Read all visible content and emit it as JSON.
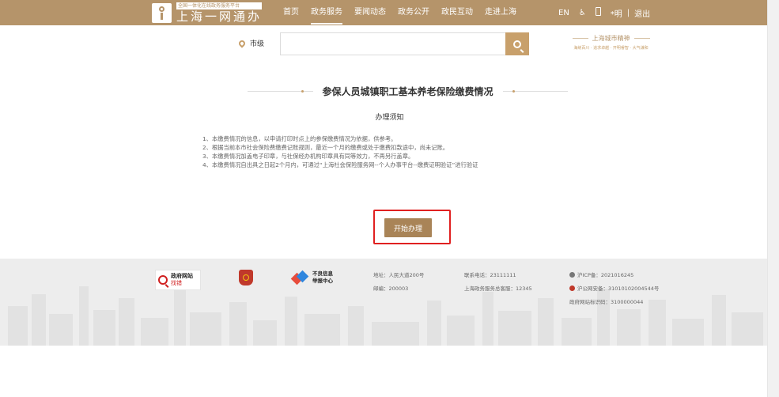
{
  "header": {
    "logo_sub": "全国一体化在线政务服务平台",
    "logo_main": "上海一网通办",
    "nav": [
      {
        "label": "首页",
        "active": false
      },
      {
        "label": "政务服务",
        "active": true
      },
      {
        "label": "要闻动态",
        "active": false
      },
      {
        "label": "政务公开",
        "active": false
      },
      {
        "label": "政民互动",
        "active": false
      },
      {
        "label": "走进上海",
        "active": false
      }
    ],
    "lang": "EN",
    "accessibility_glyph": "♿",
    "user": "*明",
    "divider": "|",
    "logout": "退出"
  },
  "search": {
    "location": "市级",
    "value": "",
    "placeholder": ""
  },
  "spirit": {
    "title": "上海城市精神",
    "subtitle": "海纳百川 · 追求卓越 · 开明睿智 · 大气谦和"
  },
  "main": {
    "title": "参保人员城镇职工基本养老保险缴费情况",
    "notice_heading": "办理须知",
    "notices": [
      "1、本缴费情况的信息，以申请打印时点上的参保缴费情况为依据，供参考。",
      "2、根据当前本市社会保险费缴费记账规则，最近一个月的缴费或处于缴费扣款途中，尚未记账。",
      "3、本缴费情况加盖电子印章，与社保经办机构印章具有同等效力，不再另行盖章。",
      "4、本缴费情况自出具之日起2个月内，可通过“上海社会保险服务网--个人办事平台--缴费证明验证”进行验证"
    ],
    "start_button": "开始办理"
  },
  "footer": {
    "gov_site_line1": "政府网站",
    "gov_site_line2": "找错",
    "report_line1": "不良信息",
    "report_line2": "举报中心",
    "address": "地址：人民大道200号",
    "postcode": "邮编：200003",
    "phone": "联系电话：23111111",
    "hotline": "上海政务服务总客服：12345",
    "icp": "沪ICP备：2021016245",
    "police": "沪公网安备：31010102004544号",
    "site_id": "政府网站标识码：3100000044"
  },
  "colors": {
    "header_bg": "#b5946a",
    "accent": "#c8a06b",
    "start_button_bg": "#a98457",
    "highlight": "#e02020",
    "footer_bg": "#ededed"
  }
}
